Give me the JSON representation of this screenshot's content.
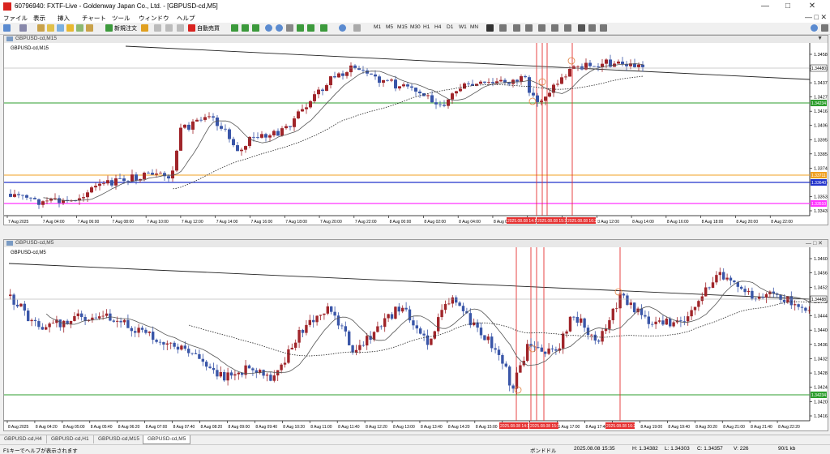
{
  "app": {
    "title": "60796940: FXTF-Live - Goldenway Japan Co., Ltd. - [GBPUSD-cd,M5]"
  },
  "menu": [
    "ファイル",
    "表示",
    "挿入",
    "チャート",
    "ツール",
    "ウィンドウ",
    "ヘルプ"
  ],
  "toolbar": {
    "new_order": "新規注文",
    "auto_trade": "自動売買",
    "timeframes": [
      "M1",
      "M5",
      "M15",
      "M30",
      "H1",
      "H4",
      "D1",
      "W1",
      "MN"
    ]
  },
  "top_chart": {
    "window_title": "GBPUSD-cd,M15",
    "symbol_label": "GBPUSD-cd,M15",
    "price_ticks": [
      "1.34585",
      "1.34480",
      "1.34375",
      "1.34270",
      "1.34165",
      "1.34060",
      "1.33955",
      "1.33850",
      "1.33745",
      "1.33640",
      "1.33535",
      "1.33430"
    ],
    "current_price": "1.34480",
    "hline_labels": {
      "green": "1.34234",
      "blue": "1.33640",
      "orange": "1.33711",
      "magenta": "1.33510"
    },
    "time_ticks": [
      "7 Aug 2025",
      "7 Aug 04:00",
      "7 Aug 06:00",
      "7 Aug 08:00",
      "7 Aug 10:00",
      "7 Aug 12:00",
      "7 Aug 14:00",
      "7 Aug 16:00",
      "7 Aug 18:00",
      "7 Aug 20:00",
      "7 Aug 22:00",
      "8 Aug 00:00",
      "8 Aug 02:00",
      "8 Aug 04:00",
      "8 Aug 06:00",
      "8 Aug 08:00",
      "8 Aug 10:00",
      "8 Aug 12:00",
      "8 Aug 14:00",
      "8 Aug 16:00",
      "8 Aug 18:00",
      "8 Aug 20:00",
      "8 Aug 22:00"
    ],
    "vline_labels": [
      "2025.08.08 14:15",
      "2025.08.08 15:35",
      "2025.08.08 16:20"
    ]
  },
  "bottom_chart": {
    "window_title": "GBPUSD-cd,M5",
    "symbol_label": "GBPUSD-cd,M5",
    "price_ticks": [
      "1.34605",
      "1.34565",
      "1.34525",
      "1.34485",
      "1.34445",
      "1.34405",
      "1.34365",
      "1.34325",
      "1.34285",
      "1.34245",
      "1.34205",
      "1.34165"
    ],
    "current_price": "1.34488",
    "hline_labels": {
      "green": "1.34234"
    },
    "time_ticks": [
      "8 Aug 2025",
      "8 Aug 04:20",
      "8 Aug 05:00",
      "8 Aug 05:40",
      "8 Aug 06:20",
      "8 Aug 07:00",
      "8 Aug 07:40",
      "8 Aug 08:20",
      "8 Aug 09:00",
      "8 Aug 09:40",
      "8 Aug 10:20",
      "8 Aug 11:00",
      "8 Aug 11:40",
      "8 Aug 12:20",
      "8 Aug 13:00",
      "8 Aug 13:40",
      "8 Aug 14:20",
      "8 Aug 15:00",
      "8 Aug 15:40",
      "8 Aug 16:20",
      "8 Aug 17:00",
      "8 Aug 17:40",
      "8 Aug 18:20",
      "8 Aug 19:00",
      "8 Aug 19:40",
      "8 Aug 20:20",
      "8 Aug 21:00",
      "8 Aug 21:40",
      "8 Aug 22:20"
    ],
    "vline_labels": [
      "2025.08.08 14:15",
      "2025.08.08 15:35",
      "2025.08.08 16:20"
    ]
  },
  "tabs": [
    "GBPUSD-cd,H4",
    "GBPUSD-cd,H1",
    "GBPUSD-cd,M15",
    "GBPUSD-cd,M5"
  ],
  "status": {
    "help": "F1キーでヘルプが表示されます",
    "profile": "ボンドドル",
    "datetime": "2025.08.08 15:35",
    "high": "H: 1.34382",
    "low": "L: 1.34303",
    "close": "C: 1.34357",
    "volume": "V: 226",
    "traffic": "90/1 kb"
  },
  "colors": {
    "bull": "#a0252a",
    "bear": "#3a56a8",
    "green_line": "#2e9e2e",
    "blue_line": "#2233cc",
    "orange_line": "#f0a020",
    "magenta_line": "#ff33ff",
    "vline": "#e53030"
  }
}
